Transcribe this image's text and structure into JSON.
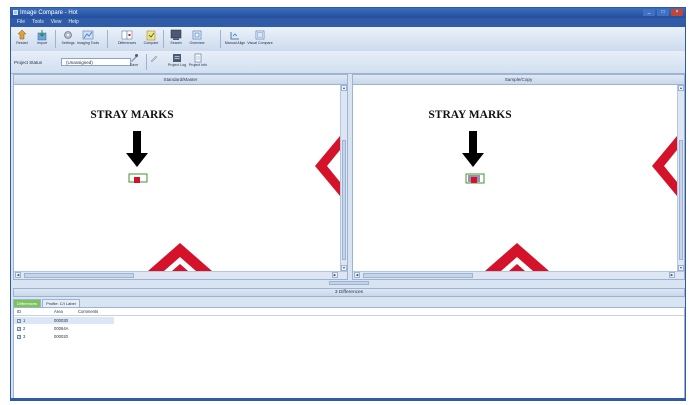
{
  "window": {
    "title": "Image Compare - Hot"
  },
  "menu": [
    "File",
    "Tools",
    "View",
    "Help"
  ],
  "toolbar": [
    {
      "label": "Restart",
      "icon": "restart-icon"
    },
    {
      "label": "Import",
      "icon": "import-icon"
    },
    {
      "label": "Settings",
      "icon": "settings-icon"
    },
    {
      "label": "Imaging Tools",
      "icon": "imaging-tools-icon"
    },
    {
      "label": "Differences",
      "icon": "differences-icon"
    },
    {
      "label": "Compare",
      "icon": "compare-icon"
    },
    {
      "label": "Search",
      "icon": "search-icon"
    },
    {
      "label": "Overview",
      "icon": "overview-icon"
    },
    {
      "label": "Manual Align",
      "icon": "manual-align-icon"
    },
    {
      "label": "Visual Compare",
      "icon": "visual-compare-icon"
    }
  ],
  "project": {
    "status_label": "Project Status",
    "status_value": "(Unassigned)",
    "save_label": "Save",
    "log_label": "Project Log",
    "info_label": "Project Info"
  },
  "panels": {
    "left": {
      "title": "Standard/Master",
      "caption": "STRAY MARKS"
    },
    "right": {
      "title": "Sample/Copy",
      "caption": "STRAY MARKS"
    }
  },
  "differences": {
    "summary": "3 Differences",
    "tabs": [
      "Differences",
      "Profile: C/I Label"
    ],
    "columns": [
      "ID",
      "Area",
      "Comments"
    ],
    "rows": [
      {
        "id": "1",
        "area": "000030",
        "checked": true
      },
      {
        "id": "2",
        "area": "00064A",
        "checked": true
      },
      {
        "id": "3",
        "area": "000020",
        "checked": true
      }
    ]
  },
  "colors": {
    "accent": "#2f5ba8",
    "marker_red": "#d4122a",
    "box_green": "#3a9a2a",
    "active_tab": "#7dc35a"
  }
}
